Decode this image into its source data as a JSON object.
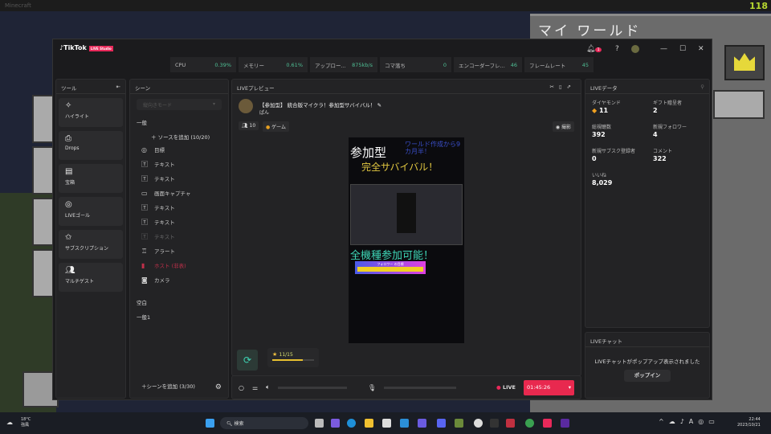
{
  "background": {
    "title": "Minecraft",
    "fps": "118",
    "world_title": "マイ ワールド"
  },
  "app": {
    "logo": "TikTok",
    "badge": "LIVE Studio",
    "notifications": "1"
  },
  "stats": [
    {
      "label": "CPU",
      "value": "0.39%"
    },
    {
      "label": "メモリー",
      "value": "0.61%"
    },
    {
      "label": "アップロー...",
      "value": "875kb/s"
    },
    {
      "label": "コマ落ち",
      "value": "0"
    },
    {
      "label": "エンコーダーフレ...",
      "value": "46"
    },
    {
      "label": "フレームレート",
      "value": "45"
    }
  ],
  "tools": {
    "title": "ツール",
    "items": [
      {
        "label": "ハイライト",
        "icon": "sparkle-icon"
      },
      {
        "label": "Drops",
        "icon": "drops-icon"
      },
      {
        "label": "宝箱",
        "icon": "treasure-icon"
      },
      {
        "label": "LIVEゴール",
        "icon": "goal-icon"
      },
      {
        "label": "サブスクリプション",
        "icon": "subscription-icon"
      },
      {
        "label": "マルチゲスト",
        "icon": "multiguest-icon"
      }
    ]
  },
  "scene": {
    "title": "シーン",
    "mode": "縦向きモード",
    "group": "一般",
    "add_source": "ソースを追加 (10/20)",
    "sources": [
      {
        "label": "目標",
        "icon": "goal-icon"
      },
      {
        "label": "テキスト",
        "icon": "text-icon"
      },
      {
        "label": "テキスト",
        "icon": "text-icon"
      },
      {
        "label": "画面キャプチャ",
        "icon": "monitor-icon"
      },
      {
        "label": "テキスト",
        "icon": "text-icon"
      },
      {
        "label": "テキスト",
        "icon": "text-icon"
      },
      {
        "label": "テキスト",
        "icon": "text-icon"
      },
      {
        "label": "アラート",
        "icon": "alert-icon"
      },
      {
        "label": "ホスト (非表)",
        "icon": "phone-icon"
      },
      {
        "label": "カメラ",
        "icon": "camera-icon"
      }
    ],
    "scenes": [
      "空白",
      "一般1"
    ],
    "add_scene": "シーンを追加 (3/30)"
  },
  "preview": {
    "title": "LIVEプレビュー",
    "stream_title": "【参加型】 統合版マイクラ！参加型サバイバル！",
    "user": "ぱん",
    "viewers": "10",
    "category": "ゲーム",
    "record": "撮影",
    "overlay": {
      "line1": "参加型",
      "line2": "ワールド作成から9カ月半！",
      "line3": "完全サバイバル！",
      "line4": "全機種参加可能！",
      "goal_label": "フォロワー の目標"
    },
    "goal": "11/15",
    "goal_progress": 0.73,
    "live_label": "LIVE",
    "timer": "01:45:26"
  },
  "live_data": {
    "title": "LIVEデータ",
    "items": [
      {
        "label": "ダイヤモンド",
        "value": "11"
      },
      {
        "label": "ギフト贈呈者",
        "value": "2"
      },
      {
        "label": "総視聴数",
        "value": "392"
      },
      {
        "label": "新規フォロワー",
        "value": "4"
      },
      {
        "label": "新規サブスク登録者",
        "value": "0"
      },
      {
        "label": "コメント",
        "value": "322"
      },
      {
        "label": "いいね",
        "value": "8,029"
      }
    ]
  },
  "chat": {
    "title": "LIVEチャット",
    "message": "LIVEチャットがポップアップ表示されました",
    "button": "ポップイン"
  },
  "taskbar": {
    "weather_temp": "18°C",
    "weather_text": "強風",
    "search": "検索",
    "time": "22:44",
    "date": "2023/10/21"
  }
}
